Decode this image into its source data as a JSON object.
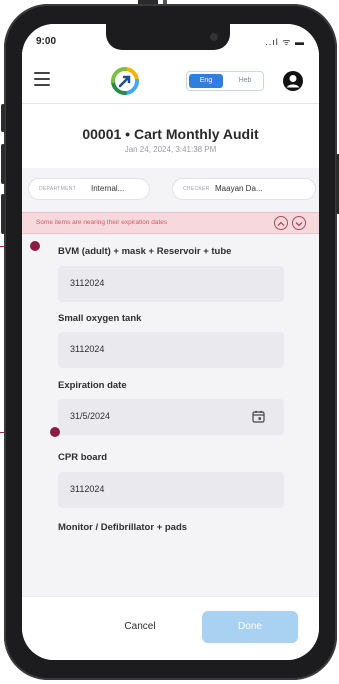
{
  "status_bar": {
    "time": "9:00",
    "icons": "..ıl ᯤ ▬"
  },
  "header": {
    "lang_eng": "Eng",
    "lang_heb": "Heb"
  },
  "audit": {
    "title": "00001 • Cart Monthly Audit",
    "date": "Jan 24, 2024, 3:41:38 PM"
  },
  "chips": {
    "department_label": "DEPARTMENT",
    "department_value": "Internal...",
    "checker_label": "CHECKER",
    "checker_value": "Maayan Da..."
  },
  "alert": {
    "text": "Some items are nearing their expiration dates"
  },
  "items": [
    {
      "label": "BVM (adult) + mask + Reservoir + tube",
      "value": "3112024"
    },
    {
      "label": "Small oxygen tank",
      "value": "3112024"
    },
    {
      "label": "Expiration date",
      "value": "31/5/2024"
    },
    {
      "label": "CPR board",
      "value": "3112024"
    },
    {
      "label": "Monitor / Defibrillator + pads"
    }
  ],
  "footer": {
    "cancel": "Cancel",
    "done": "Done"
  },
  "colors": {
    "alert_bg": "#f6d9dc",
    "accent": "#2e7fe0",
    "done_bg": "#a9d2f2",
    "callout": "#8c1d40"
  },
  "icons": [
    "menu-icon",
    "logo-icon",
    "user-icon",
    "chevron-up-icon",
    "chevron-down-icon",
    "calendar-icon"
  ]
}
